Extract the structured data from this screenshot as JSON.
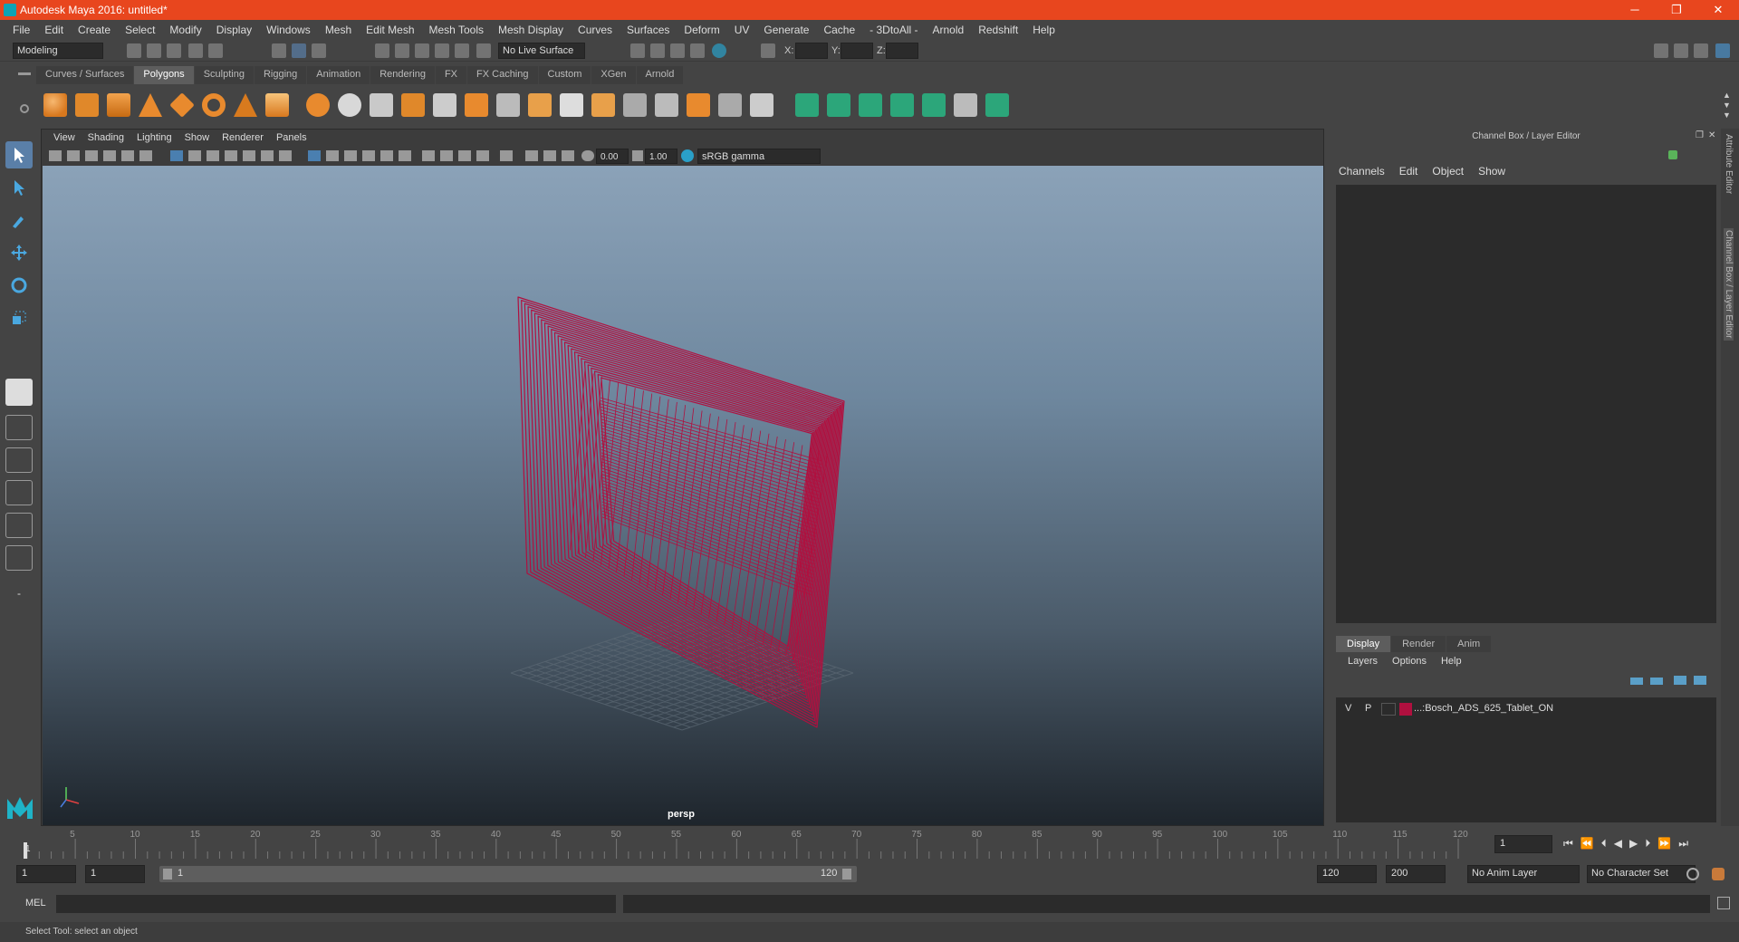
{
  "window": {
    "title": "Autodesk Maya 2016: untitled*",
    "minimize": "─",
    "restore": "❐",
    "close": "✕"
  },
  "menubar": [
    "File",
    "Edit",
    "Create",
    "Select",
    "Modify",
    "Display",
    "Windows",
    "Mesh",
    "Edit Mesh",
    "Mesh Tools",
    "Mesh Display",
    "Curves",
    "Surfaces",
    "Deform",
    "UV",
    "Generate",
    "Cache",
    "- 3DtoAll -",
    "Arnold",
    "Redshift",
    "Help"
  ],
  "statusline": {
    "mode": "Modeling",
    "live_surface": "No Live Surface",
    "x_label": "X:",
    "y_label": "Y:",
    "z_label": "Z:"
  },
  "shelf_tabs": [
    "Curves / Surfaces",
    "Polygons",
    "Sculpting",
    "Rigging",
    "Animation",
    "Rendering",
    "FX",
    "FX Caching",
    "Custom",
    "XGen",
    "Arnold"
  ],
  "shelf_active": "Polygons",
  "viewport": {
    "menu": [
      "View",
      "Shading",
      "Lighting",
      "Show",
      "Renderer",
      "Panels"
    ],
    "exposure": "0.00",
    "gamma": "1.00",
    "color_space": "sRGB gamma",
    "camera_label": "persp",
    "wire_color": "#b0103f"
  },
  "channel_box": {
    "title": "Channel Box / Layer Editor",
    "menu": [
      "Channels",
      "Edit",
      "Object",
      "Show"
    ]
  },
  "layer_editor": {
    "tabs": [
      "Display",
      "Render",
      "Anim"
    ],
    "active_tab": "Display",
    "menu": [
      "Layers",
      "Options",
      "Help"
    ],
    "layers": [
      {
        "v": "V",
        "p": "P",
        "color": "#b0103f",
        "name": "...:Bosch_ADS_625_Tablet_ON"
      }
    ]
  },
  "side_tabs": [
    "Attribute Editor",
    "Channel Box / Layer Editor"
  ],
  "timeline": {
    "ticks": [
      "5",
      "10",
      "15",
      "20",
      "25",
      "30",
      "35",
      "40",
      "45",
      "50",
      "55",
      "60",
      "65",
      "70",
      "75",
      "80",
      "85",
      "90",
      "95",
      "100",
      "105",
      "110",
      "115",
      "120"
    ],
    "current_frame": "1",
    "current_field": "1"
  },
  "range": {
    "start": "1",
    "playback_start": "1",
    "slider_start": "1",
    "slider_end": "120",
    "playback_end": "120",
    "end": "200",
    "anim_layer": "No Anim Layer",
    "character_set": "No Character Set"
  },
  "command": {
    "label": "MEL"
  },
  "help_line": "Select Tool: select an object"
}
